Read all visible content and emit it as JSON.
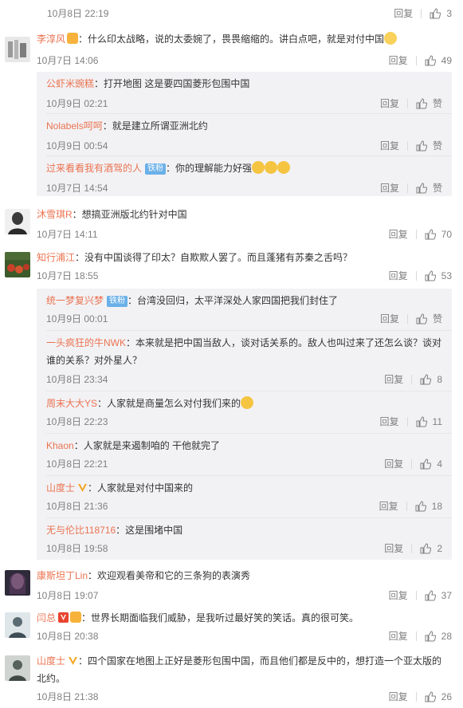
{
  "labels": {
    "reply": "回复",
    "like": "赞",
    "tiefen": "铁粉"
  },
  "top0": {
    "time": "10月8日 22:19",
    "likes": "3"
  },
  "c1": {
    "name": "李淳风",
    "text": "：什么印太战略，说的太委婉了，畏畏缩缩的。讲白点吧，就是对付中国",
    "time": "10月7日 14:06",
    "likes": "49",
    "subs": [
      {
        "name": "公虾米豌糕",
        "text": "：打开地图 这是要四国菱形包围中国",
        "time": "10月9日 02:21",
        "likes": "赞"
      },
      {
        "name": "Nolabels呵呵",
        "text": "：就是建立所谓亚洲北约",
        "time": "10月9日 00:54",
        "likes": "赞"
      },
      {
        "name": "过来看看我有酒驾的人",
        "text": "：你的理解能力好强",
        "time": "10月7日 14:54",
        "likes": "赞"
      }
    ]
  },
  "c2": {
    "name": "沐雪琪R",
    "text": "：想搞亚洲版北约针对中国",
    "time": "10月7日 14:11",
    "likes": "70"
  },
  "c3": {
    "name": "知行浦江",
    "text": "：没有中国谈得了印太？自欺欺人罢了。而且蓬猪有苏秦之舌吗？",
    "time": "10月7日 18:55",
    "likes": "53",
    "subs": [
      {
        "name": "统一梦复兴梦",
        "text": "：台湾没回归，太平洋深处人家四国把我们封住了",
        "time": "10月9日 00:01",
        "likes": "赞"
      },
      {
        "name": "一头疯狂的牛NWK",
        "text": "：本来就是把中国当敌人，谈对话关系的。敌人也叫过来了还怎么谈？谈对",
        "text2": "谁的关系？对外星人？",
        "time": "10月8日 23:34",
        "likes": "8"
      },
      {
        "name": "周末大大YS",
        "text": "：人家就是商量怎么对付我们来的",
        "time": "10月8日 22:23",
        "likes": "11"
      },
      {
        "name": "Khaon",
        "text": "：人家就是来遏制咱的 干他就完了",
        "time": "10月8日 22:21",
        "likes": "4"
      },
      {
        "name": "山度士",
        "text": "：人家就是对付中国来的",
        "time": "10月8日 21:36",
        "likes": "18"
      },
      {
        "name": "无与伦比118716",
        "text": "：这是围堵中国",
        "time": "10月8日 19:58",
        "likes": "2"
      }
    ]
  },
  "c4": {
    "name": "康斯坦丁Lin",
    "text": "：欢迎观看美帝和它的三条狗的表演秀",
    "time": "10月8日 19:07",
    "likes": "37"
  },
  "c5": {
    "name": "闫总",
    "text": "：世界长期面临我们威胁，是我听过最好笑的笑话。真的很可笑。",
    "time": "10月8日 20:38",
    "likes": "28"
  },
  "c6": {
    "name": "山度士",
    "text": "：四个国家在地图上正好是菱形包围中国，而且他们都是反中的，想打造一个亚太版的",
    "text2": "北约。",
    "time": "10月8日 21:38",
    "likes": "26"
  },
  "colors": {
    "name": "#eb7350",
    "text": "#333333",
    "meta": "#808080",
    "subbg": "#f2f2f5",
    "fan": "#6ab0e8",
    "vbadge": "#f5a623"
  }
}
